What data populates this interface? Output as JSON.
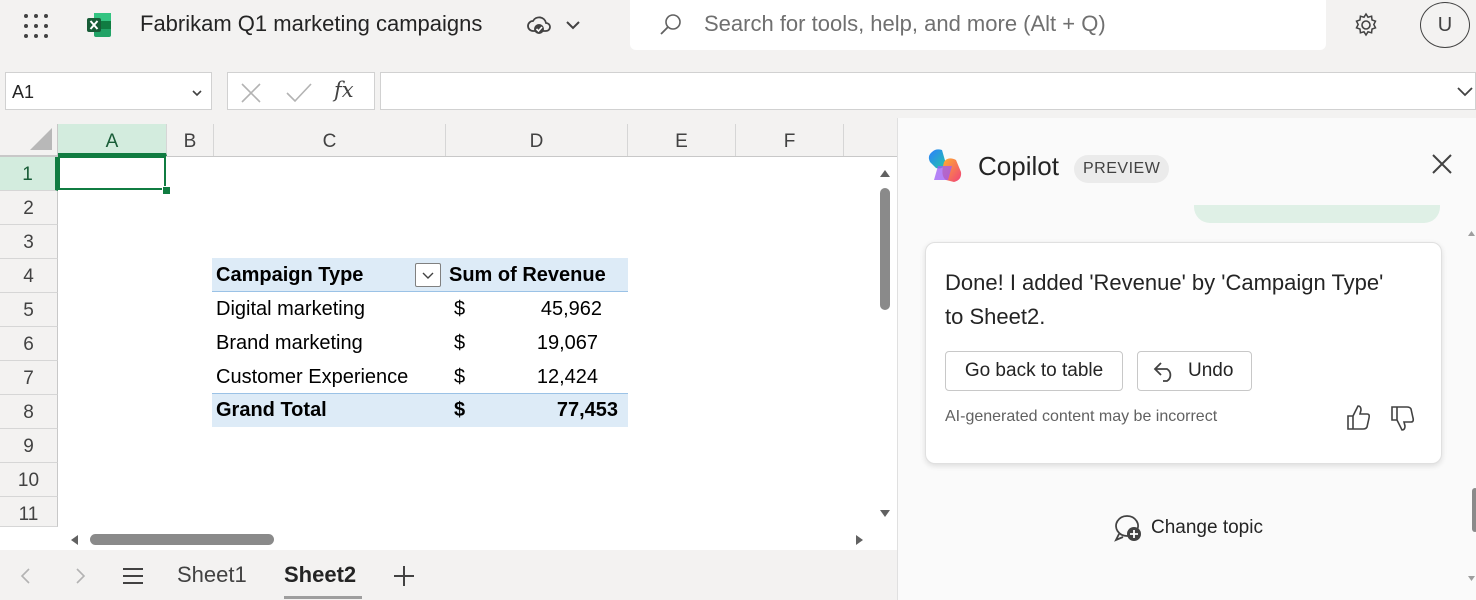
{
  "app": {
    "document_title": "Fabrikam Q1 marketing campaigns",
    "search_placeholder": "Search for tools, help, and more (Alt + Q)",
    "avatar_initial": "U"
  },
  "formula_bar": {
    "name_box": "A1",
    "formula": ""
  },
  "grid": {
    "columns": [
      "A",
      "B",
      "C",
      "D",
      "E",
      "F"
    ],
    "rows": [
      "1",
      "2",
      "3",
      "4",
      "5",
      "6",
      "7",
      "8",
      "9",
      "10",
      "11"
    ],
    "selected_cell": "A1"
  },
  "pivot": {
    "header": {
      "label": "Campaign Type",
      "value": "Sum of Revenue"
    },
    "rows": [
      {
        "label": "Digital marketing",
        "currency": "$",
        "value": "45,962"
      },
      {
        "label": "Brand marketing",
        "currency": "$",
        "value": "19,067"
      },
      {
        "label": "Customer Experience",
        "currency": "$",
        "value": "12,424"
      }
    ],
    "total": {
      "label": "Grand Total",
      "currency": "$",
      "value": "77,453"
    },
    "accent_color": "#ddebf7"
  },
  "sheets": {
    "tabs": [
      "Sheet1",
      "Sheet2"
    ],
    "active": "Sheet2"
  },
  "copilot": {
    "title": "Copilot",
    "badge": "PREVIEW",
    "message": "Done! I added 'Revenue' by 'Campaign Type' to Sheet2.",
    "go_back_label": "Go back to table",
    "undo_label": "Undo",
    "disclaimer": "AI-generated content may be incorrect",
    "change_topic_label": "Change topic"
  },
  "colors": {
    "excel_green": "#107c41",
    "selection_fill": "#d3ecde"
  }
}
